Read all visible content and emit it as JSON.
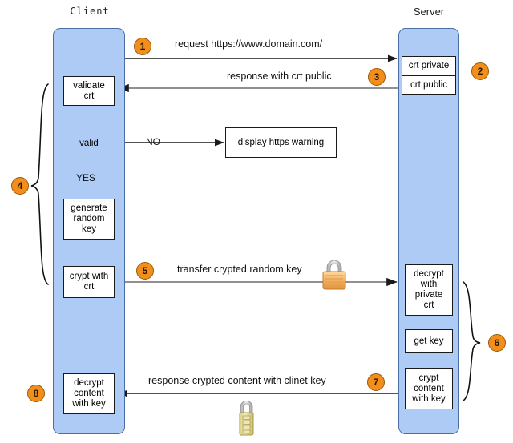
{
  "diagram": {
    "title_client": "Client",
    "title_server": "Server"
  },
  "client": {
    "nodes": [
      {
        "id": "validate-crt",
        "lines": [
          "validate",
          "crt"
        ]
      },
      {
        "id": "valid-decision",
        "lines": [
          "valid"
        ]
      },
      {
        "id": "generate-random-key",
        "lines": [
          "generate",
          "random",
          "key"
        ]
      },
      {
        "id": "crypt-with-crt",
        "lines": [
          "crypt with",
          "crt"
        ]
      },
      {
        "id": "decrypt-content-with-key",
        "lines": [
          "decrypt",
          "content",
          "with key"
        ]
      }
    ],
    "branch_yes": "YES",
    "branch_no": "NO"
  },
  "server": {
    "cert_store": [
      "crt private",
      "crt public"
    ],
    "nodes": [
      {
        "id": "decrypt-with-private-crt",
        "lines": [
          "decrypt",
          "with",
          "private",
          "crt"
        ]
      },
      {
        "id": "get-key",
        "lines": [
          "get key"
        ]
      },
      {
        "id": "crypt-content-with-key",
        "lines": [
          "crypt",
          "content",
          "with key"
        ]
      }
    ]
  },
  "external": {
    "https_warning": "display https warning"
  },
  "messages": {
    "m1": "request https://www.domain.com/",
    "m3": "response with crt public",
    "m5": "transfer crypted random key",
    "m7": "response crypted content with clinet key"
  },
  "steps": {
    "s1": "1",
    "s2": "2",
    "s3": "3",
    "s4": "4",
    "s5": "5",
    "s6": "6",
    "s7": "7",
    "s8": "8"
  },
  "icons": {
    "lock_transfer": "padlock-icon",
    "lock_response": "combination-padlock-icon"
  },
  "colors": {
    "lane_fill": "#aecbf5",
    "lane_border": "#4a6fa5",
    "badge_fill": "#f18e1c",
    "badge_border": "#9a5a0b",
    "node_border": "#1a1a1a",
    "arrow_gray": "#6b6b6b",
    "arrow_dark": "#1a1a1a",
    "background": "#ffffff"
  }
}
